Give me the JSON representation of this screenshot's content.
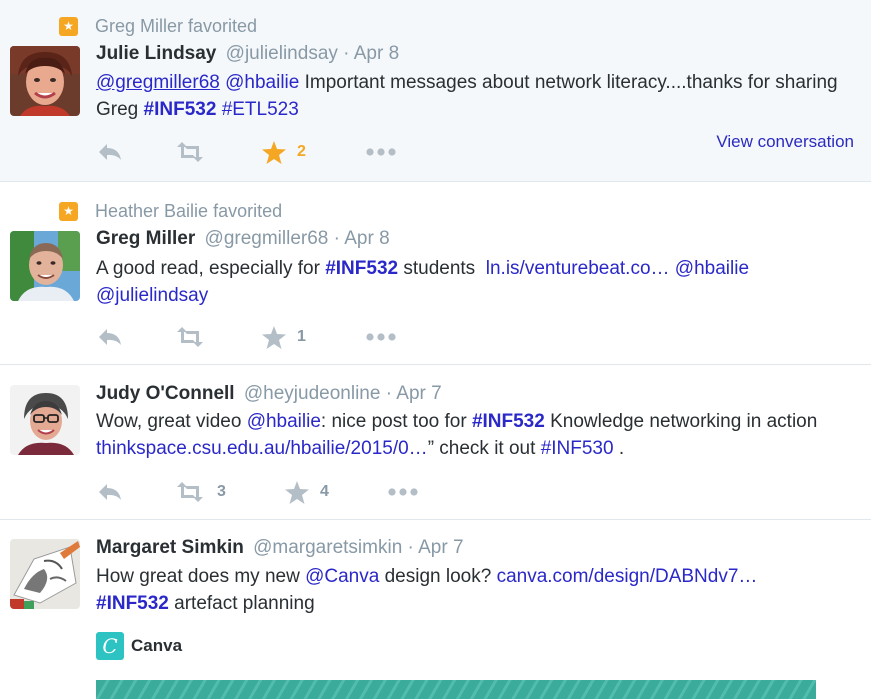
{
  "tweets": [
    {
      "context": "Greg Miller favorited",
      "fullname": "Julie Lindsay",
      "username": "@julielindsay",
      "sep": "·",
      "time": "Apr 8",
      "text": {
        "m1": "@gregmiller68",
        "m2": "@hbailie",
        "t1": " Important messages about network literacy....thanks for sharing Greg ",
        "h1": "#INF532",
        "h2": "#ETL523"
      },
      "view_conversation": "View conversation",
      "actions": {
        "retweets": "",
        "favorites": "2",
        "favorited": true
      }
    },
    {
      "context": "Heather Bailie favorited",
      "fullname": "Greg Miller",
      "username": "@gregmiller68",
      "sep": "·",
      "time": "Apr 8",
      "text": {
        "t1": "A good read, especially for ",
        "h1": "#INF532",
        "t2": " students  ",
        "url": "ln.is/venturebeat.co…",
        "m1": "@hbailie",
        "m2": "@julielindsay"
      },
      "actions": {
        "retweets": "",
        "favorites": "1",
        "favorited": false
      }
    },
    {
      "fullname": "Judy O'Connell",
      "username": "@heyjudeonline",
      "sep": "·",
      "time": "Apr 7",
      "text": {
        "t1": "Wow, great video ",
        "m1": "@hbailie",
        "t2": ": nice post too for ",
        "h1": "#INF532",
        "t3": " Knowledge networking in action ",
        "url": "thinkspace.csu.edu.au/hbailie/2015/0…",
        "t4": "” check it out ",
        "h2": "#INF530",
        "t5": " ."
      },
      "actions": {
        "retweets": "3",
        "favorites": "4",
        "favorited": false
      }
    },
    {
      "fullname": "Margaret Simkin",
      "username": "@margaretsimkin",
      "sep": "·",
      "time": "Apr 7",
      "text": {
        "t1": "How great does my new ",
        "m1": "@Canva",
        "t2": " design look? ",
        "url": "canva.com/design/DABNdv7…",
        "h1": "#INF532",
        "t3": " artefact planning"
      },
      "card": {
        "logo_letter": "C",
        "name": "Canva"
      }
    }
  ],
  "icons": {
    "favorited_badge": "star-badge-icon",
    "reply": "reply-icon",
    "retweet": "retweet-icon",
    "favorite": "star-icon",
    "more": "more-icon"
  },
  "colors": {
    "link": "#2a28c8",
    "muted": "#8899a6",
    "favorite_active": "#f5a623",
    "highlight_bg": "#f5f8fa",
    "card_teal": "#3bab9b"
  }
}
